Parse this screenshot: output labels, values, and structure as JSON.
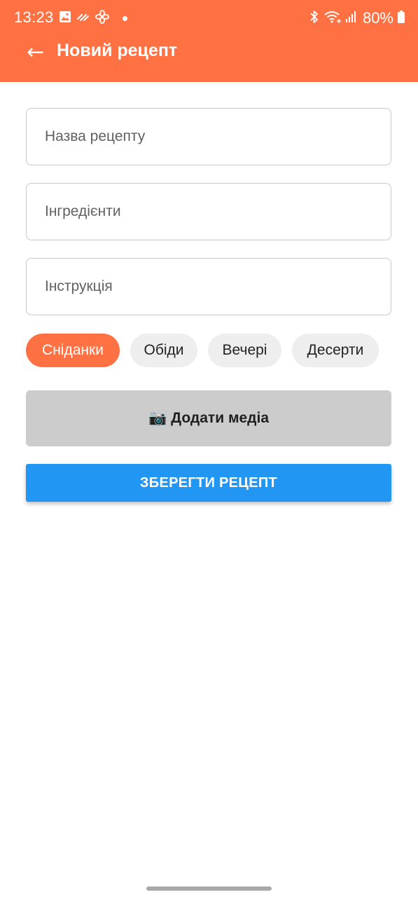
{
  "status_bar": {
    "time": "13:23",
    "battery": "80%",
    "icons_left": [
      "gallery-icon",
      "sync-icon",
      "fan-icon",
      "notification-dot"
    ],
    "icons_right": [
      "bluetooth-icon",
      "wifi-icon",
      "signal-icon",
      "battery-icon"
    ]
  },
  "app_bar": {
    "back_icon": "←",
    "title": "Новий рецепт"
  },
  "form": {
    "name_placeholder": "Назва рецепту",
    "ingredients_placeholder": "Інгредієнти",
    "instructions_placeholder": "Інструкція"
  },
  "categories": [
    {
      "label": "Сніданки",
      "selected": true
    },
    {
      "label": "Обіди",
      "selected": false
    },
    {
      "label": "Вечері",
      "selected": false
    },
    {
      "label": "Десерти",
      "selected": false
    }
  ],
  "media_button": {
    "icon": "📷",
    "label": "Додати медіа"
  },
  "save_button": {
    "label": "ЗБЕРЕГТИ РЕЦЕПТ"
  },
  "colors": {
    "accent": "#ff7143",
    "primary_button": "#2196f3",
    "chip_inactive": "#eeeeee",
    "media_button": "#cccccc"
  }
}
